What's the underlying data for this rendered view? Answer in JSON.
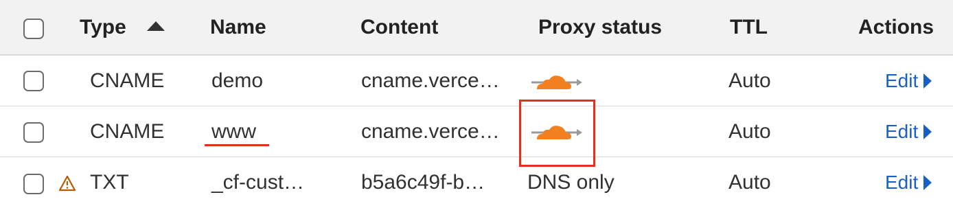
{
  "header": {
    "type": "Type",
    "name": "Name",
    "content": "Content",
    "proxy_status": "Proxy status",
    "ttl": "TTL",
    "actions": "Actions"
  },
  "rows": [
    {
      "type": "CNAME",
      "name": "demo",
      "content": "cname.verce…",
      "proxy_status": "proxied",
      "proxy_text": "",
      "ttl": "Auto",
      "action": "Edit",
      "warning": false
    },
    {
      "type": "CNAME",
      "name": "www",
      "content": "cname.verce…",
      "proxy_status": "proxied",
      "proxy_text": "",
      "ttl": "Auto",
      "action": "Edit",
      "warning": false
    },
    {
      "type": "TXT",
      "name": "_cf-cust…",
      "content": "b5a6c49f-b…",
      "proxy_status": "dns-only",
      "proxy_text": "DNS only",
      "ttl": "Auto",
      "action": "Edit",
      "warning": true
    }
  ],
  "colors": {
    "accent_link": "#1a5fc7",
    "cloud_orange": "#f38020",
    "annotation_red": "#e0301e",
    "warning": "#b35c00"
  },
  "icons": {
    "sort": "sort-ascending-icon",
    "proxy": "orange-cloud-icon",
    "warning": "warning-triangle-icon",
    "edit": "caret-right-icon"
  }
}
